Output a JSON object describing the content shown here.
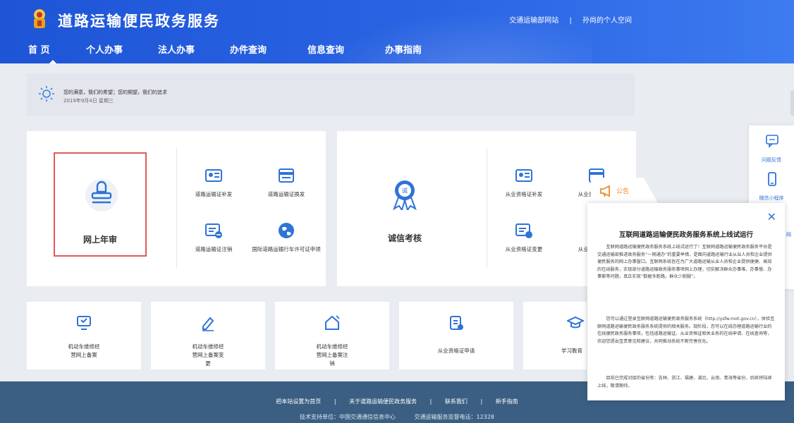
{
  "header": {
    "title": "道路运输便民政务服务",
    "top_links": [
      "交通运输部网站",
      "|",
      "孙尚的个人空间"
    ],
    "nav": [
      "首 页",
      "个人办事",
      "法人办事",
      "办件查询",
      "信息查询",
      "办事指南"
    ],
    "active_nav": "首 页",
    "brand_color": "#2a64e3"
  },
  "notice": {
    "line1": "您的满意，我们的希望；您的期望，我们的追求",
    "line2": "2019年9月4日 星期三"
  },
  "personal": {
    "featured_label": "网上年审",
    "services": [
      "道路运输证补发",
      "道路运输证换发",
      "道路运输证注销",
      "国际道路运输行车许可证申领"
    ]
  },
  "enterprise": {
    "featured_label": "诚信考核",
    "services": [
      "从业资格证补发",
      "从业资格证换发",
      "从业资格证变更",
      "从业资格证注销"
    ]
  },
  "bottom_cards": [
    "机动车维修经营网上备案",
    "机动车维修经营网上备案变更",
    "机动车维修经营网上备案注销",
    "从业资格证申请",
    "学习教育"
  ],
  "side_panel": {
    "items": [
      "问题反馈",
      "微信小程序",
      "网"
    ]
  },
  "popup": {
    "tab_label": "公告",
    "close": "✕",
    "title": "互联网道路运输便民政务服务系统上线试运行",
    "paragraphs": [
      "互联网道路运输便民政务服务系统上线试运行了！互联网道路运输便民政务服务平台是交通运输部推进政务服务“一网通办”的重要举措，是面向道路运输行业从业人员和企业提供便民服务的网上办事窗口。互联网系统旨在为广大道路运输从业人员和企业提供便捷、高效的在线服务，实现部分道路运输政务服务事项网上办理，切实解决群众办事难、办事慢、办事繁等问题，真正实现“数据多跑路，群众少跑腿”。",
      "您可以通过登录互联网道路运输便民政务服务系统（http://ysfw.mot.gov.cn），体验互联网道路运输便民政务服务系统提供的相关服务。现阶段，您可以在线办理道路运输行业的在线便民政务服务事项，包括道路运输证、从业资格证相关业务的在线申请、在线查询等，欢迎您提出宝贵意见和建议，共同推动系统不断完善优化。",
      "目前已完成对接的省份有：吉林、浙江、福建、湖北、云南、青海等省份，后续将陆续上线，敬请期待。"
    ]
  },
  "footer": {
    "links": [
      "把本站设置为首页",
      "|",
      "关于道路运输便民政务服务",
      "|",
      "联系我们",
      "|",
      "新手指南"
    ],
    "support": [
      "技术支持单位：中国交通通信信息中心",
      "交通运输服务监督电话：12328"
    ]
  }
}
